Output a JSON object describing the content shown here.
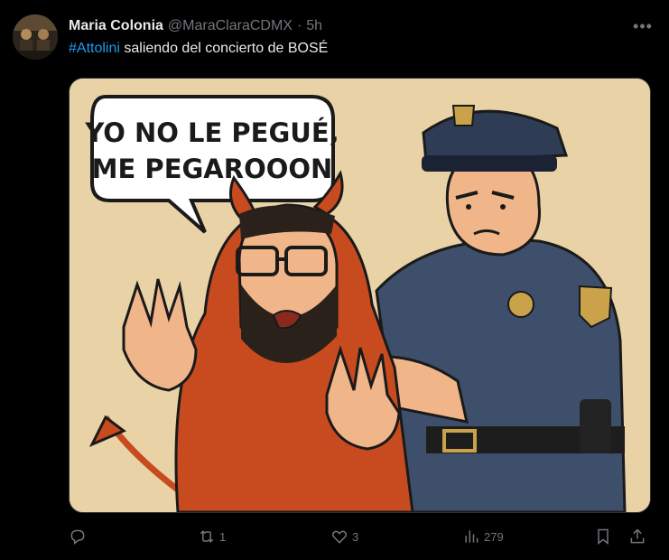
{
  "tweet": {
    "author_name": "Maria Colonia",
    "handle": "@MaraClaraCDMX",
    "separator": "·",
    "time": "5h",
    "more_icon": "more-horizontal-icon",
    "text": {
      "hashtag": "#Attolini",
      "body": " saliendo del concierto de BOSÉ"
    }
  },
  "media": {
    "speech_line1": "YO NO LE PEGUÉ,",
    "speech_line2": "ME PEGAROOON",
    "colors": {
      "background": "#e9d2a6",
      "devil_suit": "#c84b1f",
      "police_uniform": "#3d4f6b"
    }
  },
  "actions": {
    "reply": {
      "icon": "reply-icon",
      "count": ""
    },
    "retweet": {
      "icon": "retweet-icon",
      "count": "1"
    },
    "like": {
      "icon": "heart-icon",
      "count": "3"
    },
    "views": {
      "icon": "views-icon",
      "count": "279"
    },
    "bookmark": {
      "icon": "bookmark-icon"
    },
    "share": {
      "icon": "share-icon"
    }
  }
}
